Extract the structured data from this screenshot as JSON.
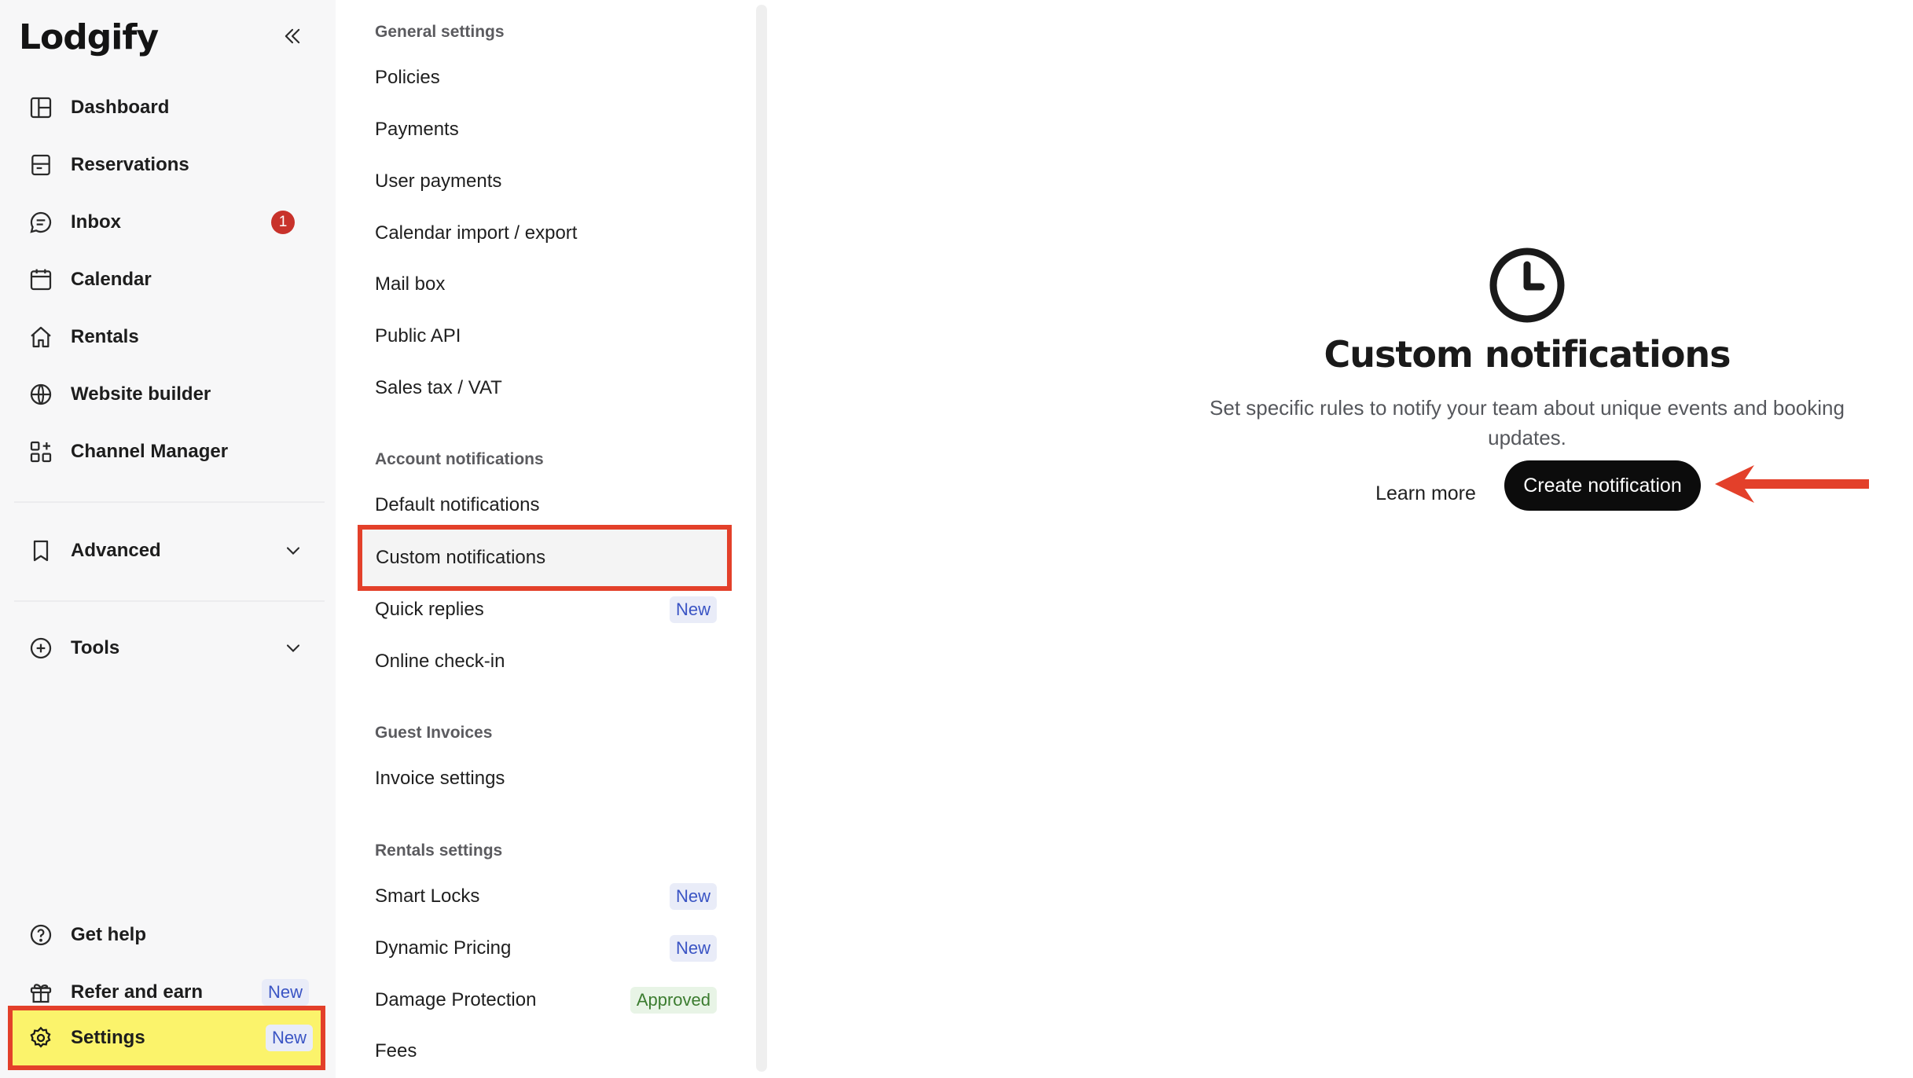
{
  "app": {
    "logo_text": "Lodgify"
  },
  "sidebar": {
    "items": [
      {
        "label": "Dashboard",
        "icon": "dashboard-icon"
      },
      {
        "label": "Reservations",
        "icon": "reservations-icon"
      },
      {
        "label": "Inbox",
        "icon": "chat-icon",
        "badge": "1"
      },
      {
        "label": "Calendar",
        "icon": "calendar-icon"
      },
      {
        "label": "Rentals",
        "icon": "home-icon"
      },
      {
        "label": "Website builder",
        "icon": "globe-icon"
      },
      {
        "label": "Channel Manager",
        "icon": "grid-plus-icon"
      },
      {
        "label": "Advanced",
        "icon": "bookmark-icon"
      },
      {
        "label": "Tools",
        "icon": "plus-circle-icon"
      }
    ],
    "bottom": [
      {
        "label": "Get help",
        "icon": "help-icon"
      },
      {
        "label": "Refer and earn",
        "icon": "gift-icon",
        "tag": "New"
      },
      {
        "label": "Settings",
        "icon": "gear-icon",
        "tag": "New",
        "selected": true
      }
    ]
  },
  "settings_menu": {
    "sections": [
      {
        "title": "General settings",
        "items": [
          {
            "label": "Policies"
          },
          {
            "label": "Payments"
          },
          {
            "label": "User payments"
          },
          {
            "label": "Calendar import / export"
          },
          {
            "label": "Mail box"
          },
          {
            "label": "Public API"
          },
          {
            "label": "Sales tax / VAT"
          }
        ]
      },
      {
        "title": "Account notifications",
        "items": [
          {
            "label": "Default notifications"
          },
          {
            "label": "Custom notifications",
            "selected": true
          },
          {
            "label": "Quick replies",
            "tag": "New"
          },
          {
            "label": "Online check-in"
          }
        ]
      },
      {
        "title": "Guest Invoices",
        "items": [
          {
            "label": "Invoice settings"
          }
        ]
      },
      {
        "title": "Rentals settings",
        "items": [
          {
            "label": "Smart Locks",
            "tag": "New"
          },
          {
            "label": "Dynamic Pricing",
            "tag": "New"
          },
          {
            "label": "Damage Protection",
            "tag": "Approved"
          },
          {
            "label": "Fees"
          }
        ]
      }
    ]
  },
  "main": {
    "icon": "clock-icon",
    "title": "Custom notifications",
    "description": "Set specific rules to notify your team about unique events and booking updates.",
    "learn_more": "Learn more",
    "create_button": "Create notification"
  },
  "colors": {
    "highlight_outline": "#e3402a",
    "settings_highlight": "#fbf36b",
    "new_tag_text": "#3a54c4",
    "approved_tag_text": "#3b7c2f",
    "badge": "#c8322b"
  }
}
